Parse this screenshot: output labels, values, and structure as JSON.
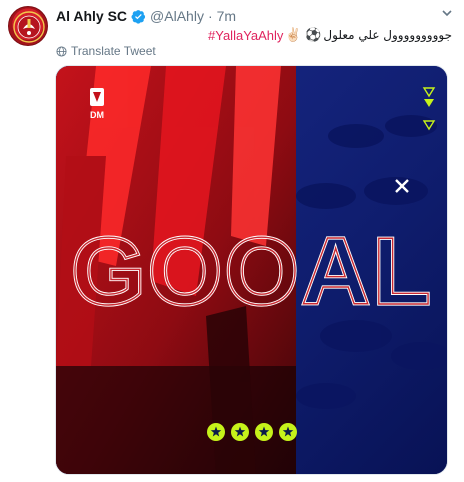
{
  "tweet": {
    "display_name": "Al Ahly SC",
    "handle": "@AlAhly",
    "separator": "·",
    "time": "7m",
    "hashtag": "#YallaYaAhly",
    "emojis": "✌🏻 ⚽",
    "arabic_text": "جووووووووول علي معلول",
    "translate_label": "Translate Tweet"
  },
  "media": {
    "goal_text": "GOOAL",
    "logo_text": "DM",
    "stars_count": 4
  },
  "colors": {
    "hashtag": "#e0245e",
    "verified": "#1da1f2",
    "brand_red": "#d4202a",
    "navy": "#14206e",
    "accent_yellow": "#c6f21a"
  }
}
